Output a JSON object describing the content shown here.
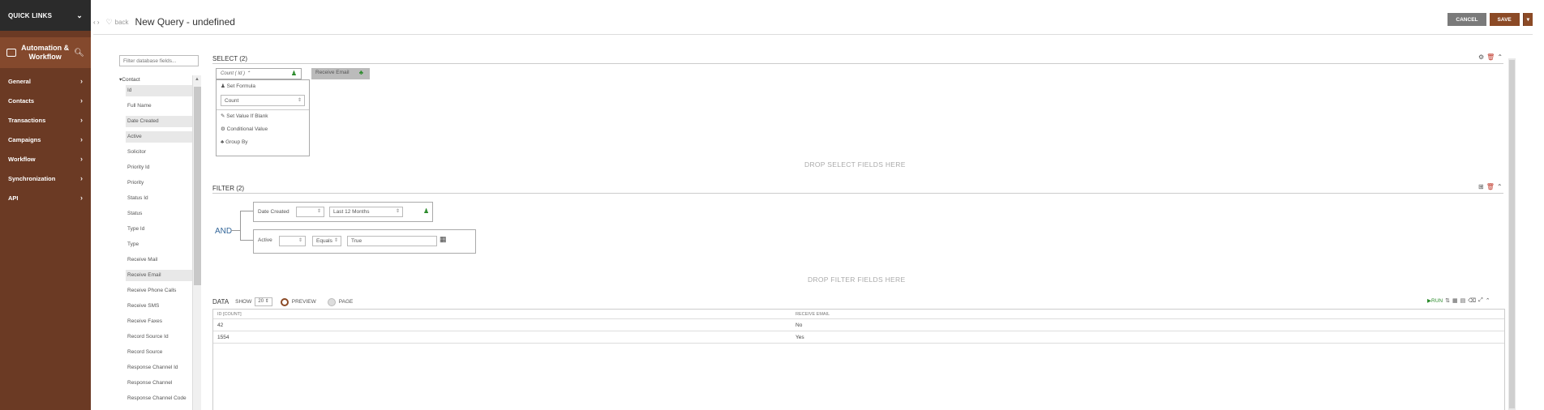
{
  "sidebar": {
    "quick_links": "QUICK LINKS",
    "module_title": "Automation & Workflow",
    "items": [
      {
        "label": "General"
      },
      {
        "label": "Contacts"
      },
      {
        "label": "Transactions"
      },
      {
        "label": "Campaigns"
      },
      {
        "label": "Workflow"
      },
      {
        "label": "Synchronization"
      },
      {
        "label": "API"
      }
    ]
  },
  "header": {
    "back_label": "back",
    "title": "New Query - undefined",
    "cancel_label": "CANCEL",
    "save_label": "SAVE"
  },
  "fields": {
    "filter_placeholder": "Filter database fields...",
    "category": "Contact",
    "items": [
      {
        "label": "Id",
        "highlighted": true
      },
      {
        "label": "Full Name",
        "highlighted": false
      },
      {
        "label": "Date Created",
        "highlighted": true
      },
      {
        "label": "Active",
        "highlighted": true
      },
      {
        "label": "Solicitor",
        "highlighted": false
      },
      {
        "label": "Priority Id",
        "highlighted": false
      },
      {
        "label": "Priority",
        "highlighted": false
      },
      {
        "label": "Status Id",
        "highlighted": false
      },
      {
        "label": "Status",
        "highlighted": false
      },
      {
        "label": "Type Id",
        "highlighted": false
      },
      {
        "label": "Type",
        "highlighted": false
      },
      {
        "label": "Receive Mail",
        "highlighted": false
      },
      {
        "label": "Receive Email",
        "highlighted": true
      },
      {
        "label": "Receive Phone Calls",
        "highlighted": false
      },
      {
        "label": "Receive SMS",
        "highlighted": false
      },
      {
        "label": "Receive Faxes",
        "highlighted": false
      },
      {
        "label": "Record Source Id",
        "highlighted": false
      },
      {
        "label": "Record Source",
        "highlighted": false
      },
      {
        "label": "Response Channel Id",
        "highlighted": false
      },
      {
        "label": "Response Channel",
        "highlighted": false
      },
      {
        "label": "Response Channel Code",
        "highlighted": false
      }
    ]
  },
  "select": {
    "title": "SELECT",
    "count": "(2)",
    "pill1": "Count ( Id )",
    "pill2": "Receive Email",
    "drop_text": "DROP SELECT FIELDS HERE",
    "dropdown": {
      "set_formula": "Set Formula",
      "formula_value": "Count",
      "set_value_if_blank": "Set Value If Blank",
      "conditional_value": "Conditional Value",
      "group_by": "Group By"
    }
  },
  "filter": {
    "title": "FILTER",
    "count": "(2)",
    "operator": "AND",
    "drop_text": "DROP FILTER FIELDS HERE",
    "rows": [
      {
        "field": "Date Created",
        "op": "",
        "value": "Last 12 Months"
      },
      {
        "field": "Active",
        "op": "Equals",
        "value": "True"
      }
    ]
  },
  "data": {
    "title": "DATA",
    "show_label": "SHOW",
    "show_value": "20",
    "preview_label": "PREVIEW",
    "page_label": "PAGE",
    "run_label": "RUN",
    "columns": [
      "ID [COUNT]",
      "RECEIVE EMAIL"
    ],
    "rows": [
      [
        "42",
        "No"
      ],
      [
        "1554",
        "Yes"
      ]
    ]
  },
  "colors": {
    "sidebar_bg": "#6b3a24",
    "quick_links_bg": "#2b2b2b",
    "accent": "#8b4a26",
    "cancel_btn": "#7a7a7a",
    "and_text": "#336699"
  }
}
